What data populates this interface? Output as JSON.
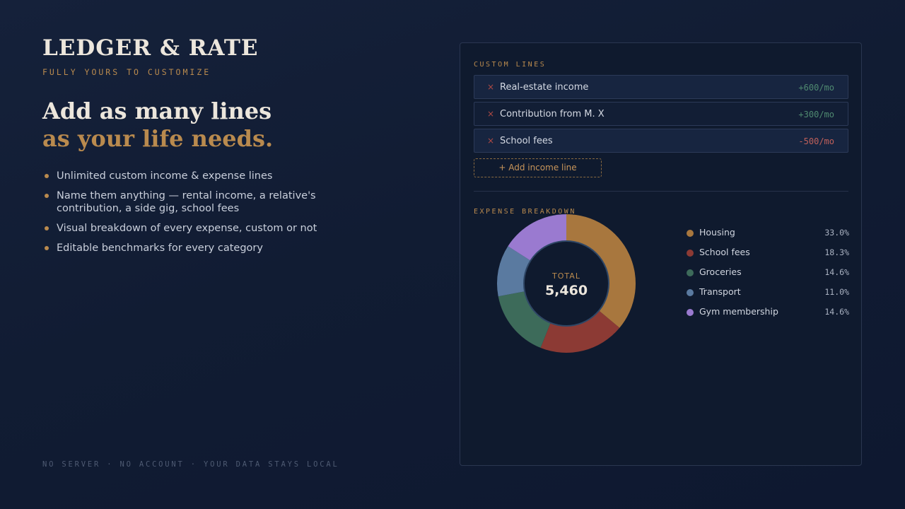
{
  "brand": {
    "title": "LEDGER & RATE",
    "tagline": "FULLY YOURS TO CUSTOMIZE"
  },
  "hero": {
    "line1": "Add as many lines",
    "line2": "as your life needs."
  },
  "features": [
    "Unlimited custom income & expense lines",
    "Name them anything — rental income, a relative's contribution, a side gig, school fees",
    "Visual breakdown of every expense, custom or not",
    "Editable benchmarks for every category"
  ],
  "footer": "NO SERVER · NO ACCOUNT · YOUR DATA STAYS LOCAL",
  "panel": {
    "custom_lines_label": "CUSTOM LINES",
    "lines": [
      {
        "remove": "×",
        "name": "Real-estate income",
        "amount": "+600/mo",
        "kind": "pos"
      },
      {
        "remove": "×",
        "name": "Contribution from M. X",
        "amount": "+300/mo",
        "kind": "pos"
      },
      {
        "remove": "×",
        "name": "School fees",
        "amount": "-500/mo",
        "kind": "neg"
      }
    ],
    "add_button": "+ Add income line",
    "breakdown_label": "EXPENSE BREAKDOWN"
  },
  "colors": {
    "accent": "#b98a4e",
    "positive": "#4f8a70",
    "negative": "#c0605a",
    "background": "#111c33"
  },
  "chart_data": {
    "type": "pie",
    "center_label": "TOTAL",
    "center_value": "5,460",
    "categories": [
      "Housing",
      "School fees",
      "Groceries",
      "Transport",
      "Gym membership"
    ],
    "values": [
      33.0,
      18.3,
      14.6,
      11.0,
      14.6
    ],
    "value_labels": [
      "33.0%",
      "18.3%",
      "14.6%",
      "11.0%",
      "14.6%"
    ],
    "colors": [
      "#a8773e",
      "#8c3a34",
      "#3d6b5a",
      "#5a7aa0",
      "#9a7ad0"
    ],
    "legend_position": "right"
  }
}
